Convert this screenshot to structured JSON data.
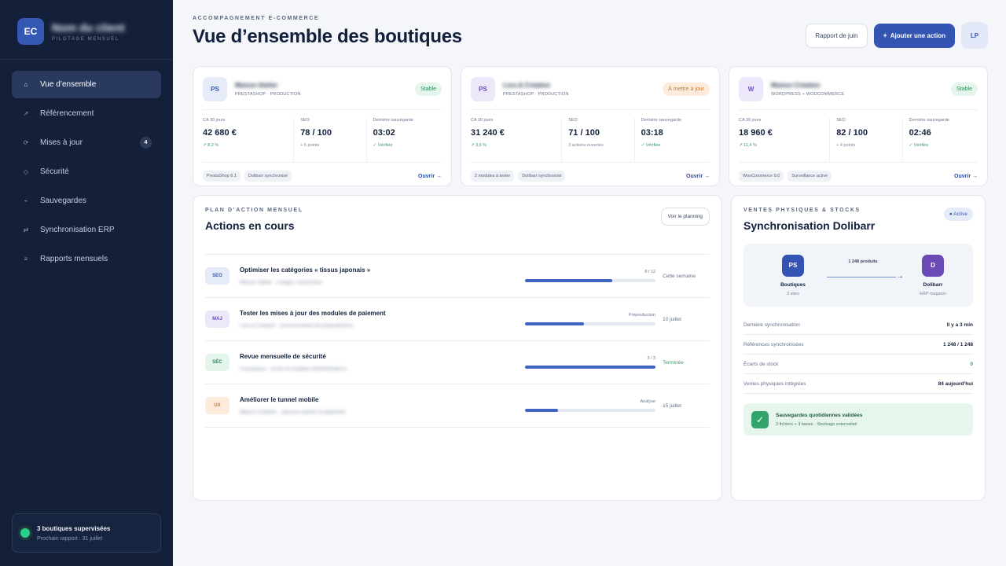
{
  "brand": {
    "initials": "EC",
    "name": "Nom du client",
    "subtitle": "PILOTAGE MENSUEL"
  },
  "nav": [
    {
      "icon": "⌂",
      "label": "Vue d’ensemble",
      "active": true
    },
    {
      "icon": "↗",
      "label": "Référencement"
    },
    {
      "icon": "⟳",
      "label": "Mises à jour",
      "badge": "4"
    },
    {
      "icon": "◇",
      "label": "Sécurité"
    },
    {
      "icon": "⌁",
      "label": "Sauvegardes"
    },
    {
      "icon": "⇄",
      "label": "Synchronisation ERP"
    },
    {
      "icon": "≡",
      "label": "Rapports mensuels"
    }
  ],
  "sidebar_footer": {
    "title": "3 boutiques supervisées",
    "subtitle": "Prochain rapport : 31 juillet"
  },
  "header": {
    "eyebrow": "ACCOMPAGNEMENT E-COMMERCE",
    "title": "Vue d’ensemble des boutiques",
    "report_button": "Rapport de juin",
    "add_button": "Ajouter une action",
    "add_icon": "+",
    "avatar": "LP"
  },
  "shops": [
    {
      "logo": "PS",
      "name": "Maison Atelier",
      "platform": "PRESTASHOP · PRODUCTION",
      "status": "Stable",
      "ca_label": "CA 30 jours",
      "ca_value": "42 680 €",
      "ca_sub": "↗ 8,2 %",
      "seo_label": "SEO",
      "seo_value": "78 / 100",
      "seo_sub": "+ 6 points",
      "backup_label": "Dernière sauvegarde",
      "backup_value": "03:02",
      "backup_sub": "✓ Vérifiée",
      "tags": [
        "PrestaShop 8.1",
        "Dolibarr synchronisé"
      ],
      "open": "Ouvrir →"
    },
    {
      "logo": "PS",
      "name": "Lora & Création",
      "platform": "PRESTASHOP · PRODUCTION",
      "status": "À mettre à jour",
      "ca_label": "CA 30 jours",
      "ca_value": "31 240 €",
      "ca_sub": "↗ 3,6 %",
      "seo_label": "SEO",
      "seo_value": "71 / 100",
      "seo_sub": "3 actions ouvertes",
      "backup_label": "Dernière sauvegarde",
      "backup_value": "03:18",
      "backup_sub": "✓ Vérifiée",
      "tags": [
        "2 modules à tester",
        "Dolibarr synchronisé"
      ],
      "open": "Ouvrir →"
    },
    {
      "logo": "W",
      "name": "Maison Création",
      "platform": "WORDPRESS + WOOCOMMERCE",
      "status": "Stable",
      "ca_label": "CA 30 jours",
      "ca_value": "18 960 €",
      "ca_sub": "↗ 11,4 %",
      "seo_label": "SEO",
      "seo_value": "82 / 100",
      "seo_sub": "+ 4 points",
      "backup_label": "Dernière sauvegarde",
      "backup_value": "02:46",
      "backup_sub": "✓ Vérifiée",
      "tags": [
        "WooCommerce 9.0",
        "Surveillance active"
      ],
      "open": "Ouvrir →"
    }
  ],
  "actions": {
    "eyebrow": "PLAN D’ACTION MENSUEL",
    "title": "Actions en cours",
    "planning_button": "Voir le planning",
    "items": [
      {
        "tag": "SEO",
        "title": "Optimiser les catégories « tissus japonais »",
        "sub": "Maison Atelier · 3 pages concernées",
        "progress_label": "8 / 12",
        "progress": 0.67,
        "due": "Cette semaine"
      },
      {
        "tag": "MAJ",
        "title": "Tester les mises à jour des modules de paiement",
        "sub": "Lora & Création · environnement de préproduction",
        "progress_label": "Préproduction",
        "progress": 0.45,
        "due": "10 juillet"
      },
      {
        "tag": "SÉC",
        "title": "Revue mensuelle de sécurité",
        "sub": "3 boutiques · accès et comptes administrateurs",
        "progress_label": "3 / 3",
        "progress": 1.0,
        "due": "Terminée"
      },
      {
        "tag": "UX",
        "title": "Améliorer le tunnel mobile",
        "sub": "Maison Création · parcours panier et paiement",
        "progress_label": "Analyse",
        "progress": 0.25,
        "due": "15 juillet"
      }
    ]
  },
  "sync": {
    "eyebrow": "VENTES PHYSIQUES & STOCKS",
    "title": "Synchronisation Dolibarr",
    "status": "● Active",
    "source": {
      "icon": "PS",
      "title": "Boutiques",
      "sub": "3 sites"
    },
    "target": {
      "icon": "D",
      "title": "Dolibarr",
      "sub": "ERP magasin"
    },
    "count": "1 248 produits",
    "arrow": "→",
    "stats": [
      {
        "label": "Dernière synchronisation",
        "value": "Il y a 3 min"
      },
      {
        "label": "Références synchronisées",
        "value": "1 248 / 1 248"
      },
      {
        "label": "Écarts de stock",
        "value": "0"
      },
      {
        "label": "Ventes physiques intégrées",
        "value": "84 aujourd’hui"
      }
    ],
    "backup": {
      "icon": "✓",
      "title": "Sauvegardes quotidiennes validées",
      "sub": "3 fichiers + 3 bases · Stockage externalisé"
    }
  }
}
